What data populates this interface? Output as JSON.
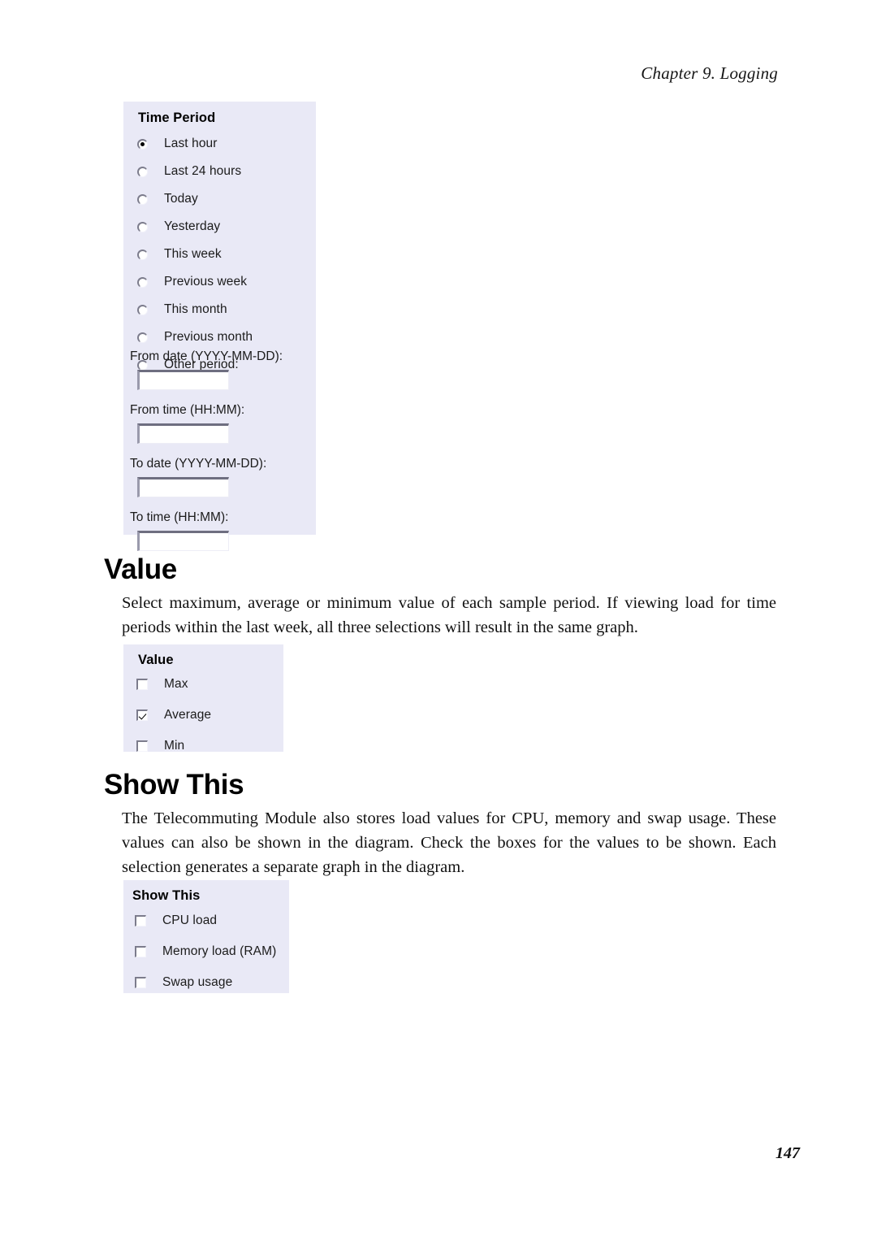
{
  "header": {
    "chapter": "Chapter 9. Logging"
  },
  "footer": {
    "page_number": "147"
  },
  "time_period_panel": {
    "title": "Time Period",
    "options": [
      {
        "label": "Last hour",
        "selected": true
      },
      {
        "label": "Last 24 hours",
        "selected": false
      },
      {
        "label": "Today",
        "selected": false
      },
      {
        "label": "Yesterday",
        "selected": false
      },
      {
        "label": "This week",
        "selected": false
      },
      {
        "label": "Previous week",
        "selected": false
      },
      {
        "label": "This month",
        "selected": false
      },
      {
        "label": "Previous month",
        "selected": false
      },
      {
        "label": "Other period:",
        "selected": false
      }
    ],
    "fields": [
      {
        "label": "From date (YYYY-MM-DD):",
        "value": ""
      },
      {
        "label": "From time (HH:MM):",
        "value": ""
      },
      {
        "label": "To date (YYYY-MM-DD):",
        "value": ""
      },
      {
        "label": "To time (HH:MM):",
        "value": ""
      }
    ]
  },
  "value_section": {
    "heading": "Value",
    "paragraph": "Select maximum, average or minimum value of each sample period. If viewing load for time periods within the last week, all three selections will result in the same graph.",
    "panel": {
      "title": "Value",
      "options": [
        {
          "label": "Max",
          "checked": false
        },
        {
          "label": "Average",
          "checked": true
        },
        {
          "label": "Min",
          "checked": false
        }
      ]
    }
  },
  "show_this_section": {
    "heading": "Show This",
    "paragraph": "The Telecommuting Module also stores load values for CPU, memory and swap usage. These values can also be shown in the diagram. Check the boxes for the values to be shown. Each selection generates a separate graph in the diagram.",
    "panel": {
      "title": "Show This",
      "options": [
        {
          "label": "CPU load",
          "checked": false
        },
        {
          "label": "Memory load (RAM)",
          "checked": false
        },
        {
          "label": "Swap usage",
          "checked": false
        }
      ]
    }
  },
  "colors": {
    "panel_background": "#e9e9f6",
    "text": "#111111",
    "page_background": "#ffffff"
  }
}
